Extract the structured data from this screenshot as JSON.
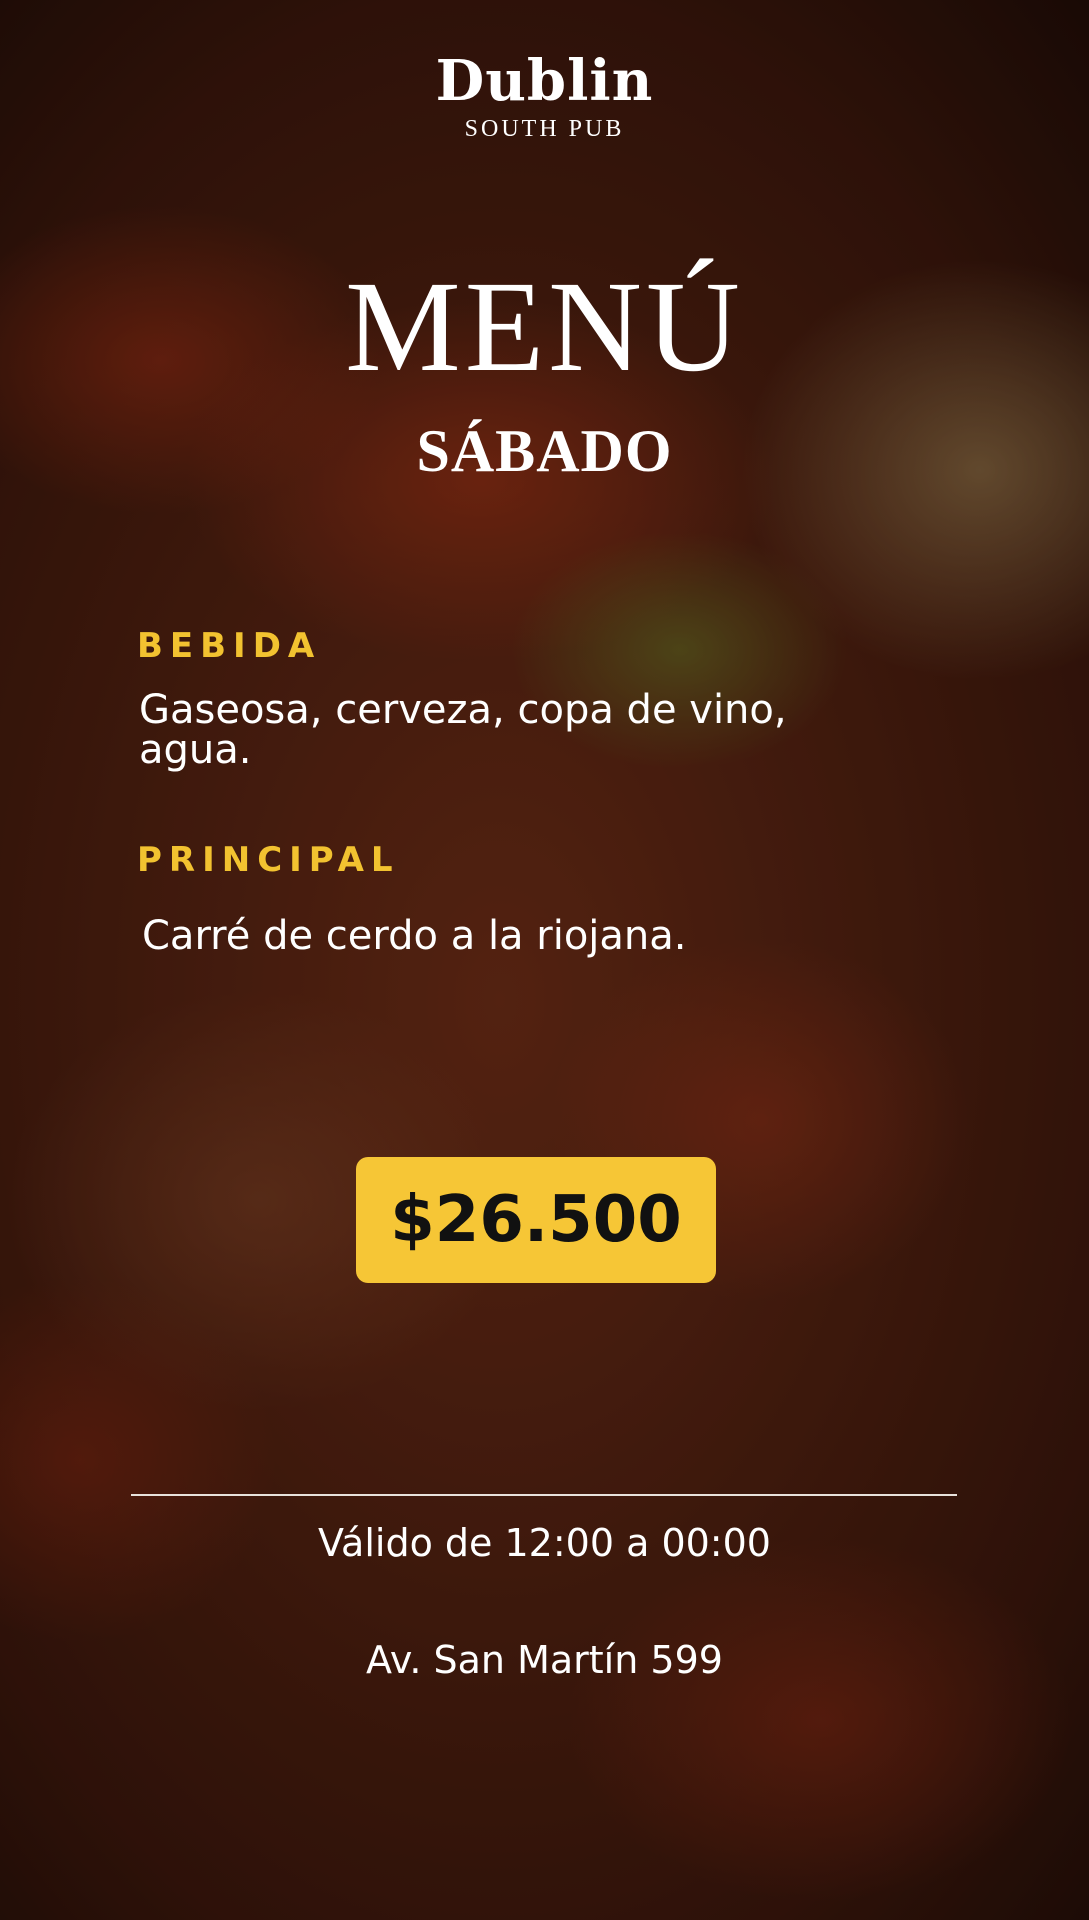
{
  "brand": {
    "name": "Dublin",
    "subtitle": "SOUTH PUB"
  },
  "menu": {
    "title": "MENÚ",
    "day": "SÁBADO"
  },
  "sections": {
    "bebida": {
      "label": "BEBIDA",
      "text": "Gaseosa, cerveza, copa de vino, agua."
    },
    "principal": {
      "label": "PRINCIPAL",
      "text": "Carré de cerdo a la riojana."
    }
  },
  "price": "$26.500",
  "footer": {
    "hours": "Válido de 12:00 a 00:00",
    "address": "Av. San Martín 599"
  },
  "colors": {
    "accent": "#f6c636",
    "label": "#f2c230",
    "text": "#ffffff"
  }
}
